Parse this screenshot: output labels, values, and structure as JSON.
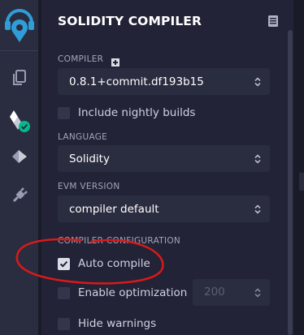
{
  "panel": {
    "title": "SOLIDITY COMPILER"
  },
  "compiler": {
    "label": "COMPILER",
    "version": "0.8.1+commit.df193b15",
    "include_nightly_label": "Include nightly builds",
    "include_nightly_checked": false
  },
  "language": {
    "label": "LANGUAGE",
    "value": "Solidity"
  },
  "evm": {
    "label": "EVM VERSION",
    "value": "compiler default"
  },
  "configuration": {
    "label": "COMPILER CONFIGURATION",
    "auto_compile_label": "Auto compile",
    "auto_compile_checked": true,
    "enable_optimization_label": "Enable optimization",
    "enable_optimization_checked": false,
    "optimization_runs": "200",
    "hide_warnings_label": "Hide warnings",
    "hide_warnings_checked": false
  },
  "icons": {
    "logo": "remix-logo-icon",
    "file_explorer": "files-icon",
    "compiler": "solidity-compiler-icon",
    "deploy": "ethereum-deploy-icon",
    "plugins": "plug-icon",
    "docs": "documentation-icon"
  },
  "colors": {
    "accent_blue": "#2f9ed8",
    "success_green": "#00bc8c",
    "annotation_red": "#d81a1a"
  }
}
